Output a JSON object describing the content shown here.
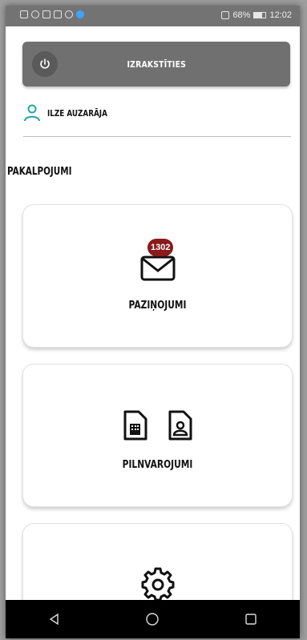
{
  "status_bar": {
    "battery": "68%",
    "time": "12:02",
    "battery_level": 0.68
  },
  "header": {
    "logout_label": "IZRAKSTĪTIES"
  },
  "user": {
    "name": "ILZE AUZARĀJA"
  },
  "services": {
    "title": "PAKALPOJUMI",
    "cards": [
      {
        "label": "PAZIŅOJUMI",
        "badge": "1302",
        "icon": "envelope-icon"
      },
      {
        "label": "PILNVAROJUMI",
        "icon": "documents-icon"
      },
      {
        "label": "",
        "icon": "gear-icon"
      }
    ]
  },
  "colors": {
    "accent": "#2aa3a3",
    "badge": "#8b1a1a",
    "header": "#707070"
  }
}
